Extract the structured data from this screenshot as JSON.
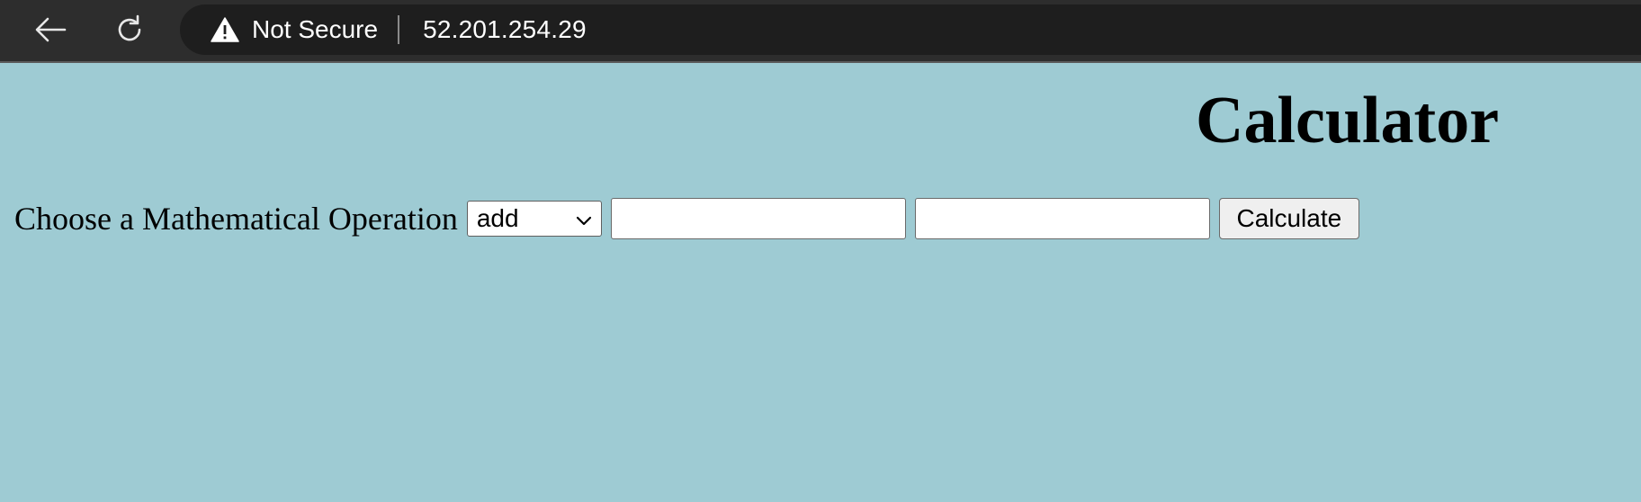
{
  "browser": {
    "security_label": "Not Secure",
    "url": "52.201.254.29",
    "icons": {
      "back": "arrow-left-icon",
      "reload": "reload-icon",
      "warning": "warning-icon"
    }
  },
  "page": {
    "title": "Calculator",
    "background_color": "#9ecbd3",
    "operation_label": "Choose a Mathematical Operation",
    "operation_select": {
      "selected": "add"
    },
    "first_number": {
      "value": "",
      "placeholder": ""
    },
    "second_number": {
      "value": "",
      "placeholder": ""
    },
    "calculate_label": "Calculate"
  }
}
